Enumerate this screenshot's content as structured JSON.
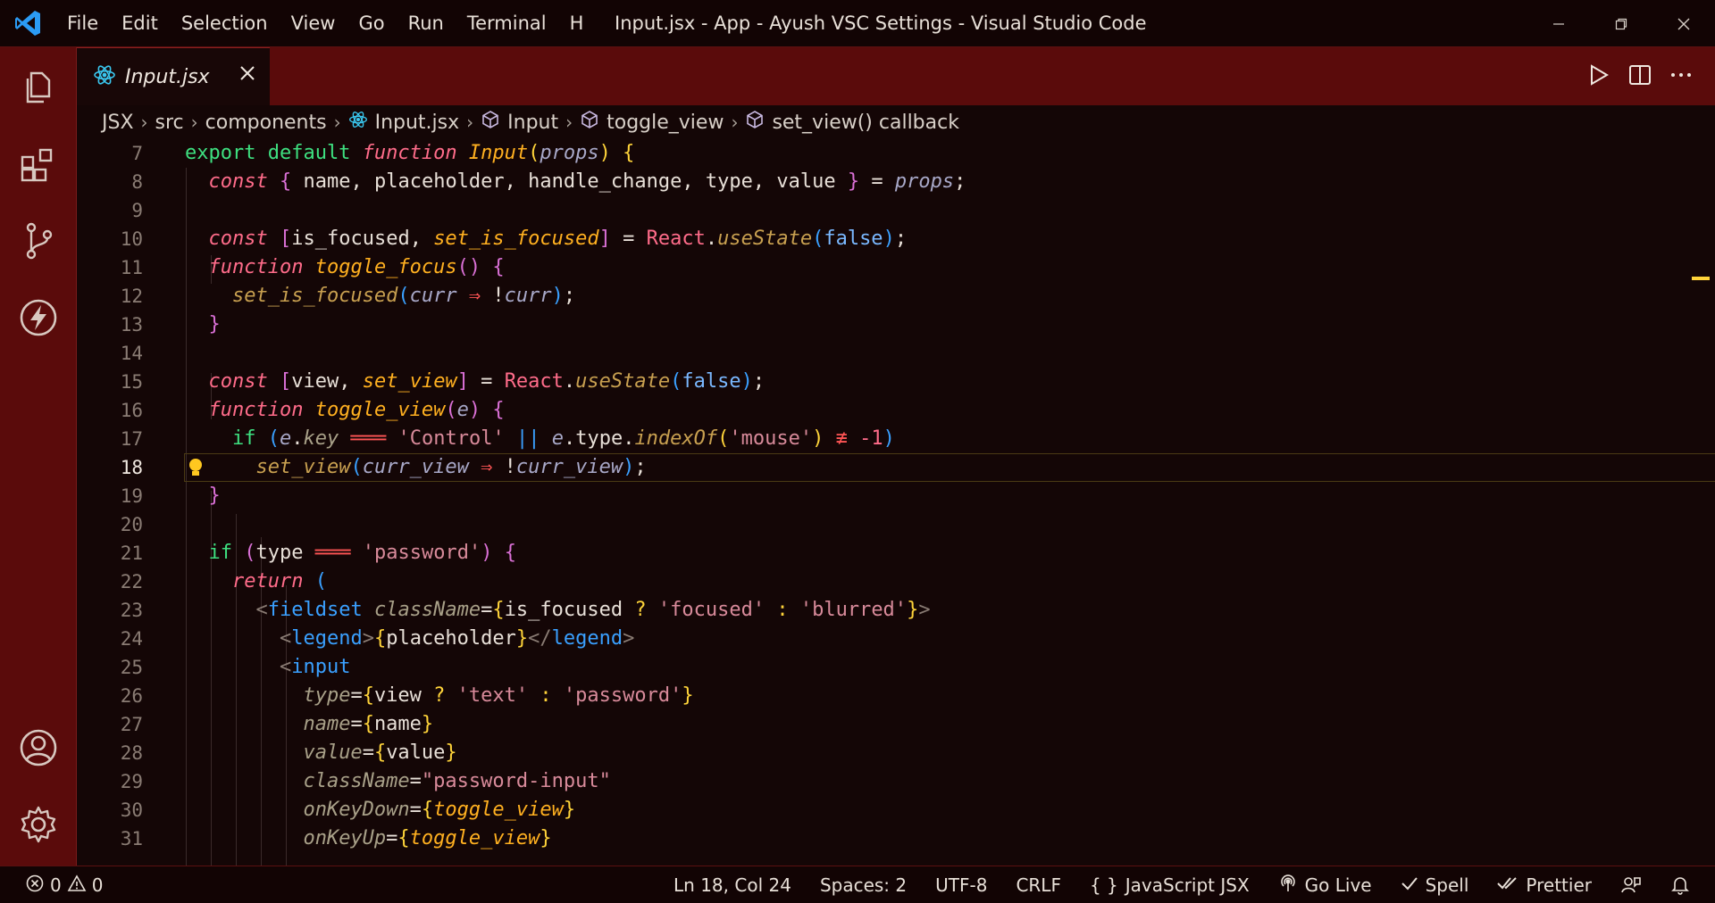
{
  "titlebar": {
    "menu": [
      "File",
      "Edit",
      "Selection",
      "View",
      "Go",
      "Run",
      "Terminal",
      "H"
    ],
    "title": "Input.jsx - App - Ayush VSC Settings - Visual Studio Code"
  },
  "tab": {
    "label": "Input.jsx"
  },
  "breadcrumb": [
    "JSX",
    "src",
    "components",
    "Input.jsx",
    "Input",
    "toggle_view",
    "set_view() callback"
  ],
  "editor": {
    "active_line": 18,
    "line_numbers": [
      "7",
      "8",
      "9",
      "10",
      "11",
      "12",
      "13",
      "14",
      "15",
      "16",
      "17",
      "18",
      "19",
      "20",
      "21",
      "22",
      "23",
      "24",
      "25",
      "26",
      "27",
      "28",
      "29",
      "30",
      "31"
    ]
  },
  "statusbar": {
    "errors": "0",
    "warnings": "0",
    "position": "Ln 18, Col 24",
    "spaces": "Spaces: 2",
    "encoding": "UTF-8",
    "eol": "CRLF",
    "language": "JavaScript JSX",
    "go_live": "Go Live",
    "spell": "Spell",
    "prettier": "Prettier"
  },
  "colors": {
    "accent": "#5a0b0b",
    "background": "#140606",
    "cursor": "#ffd43a"
  }
}
